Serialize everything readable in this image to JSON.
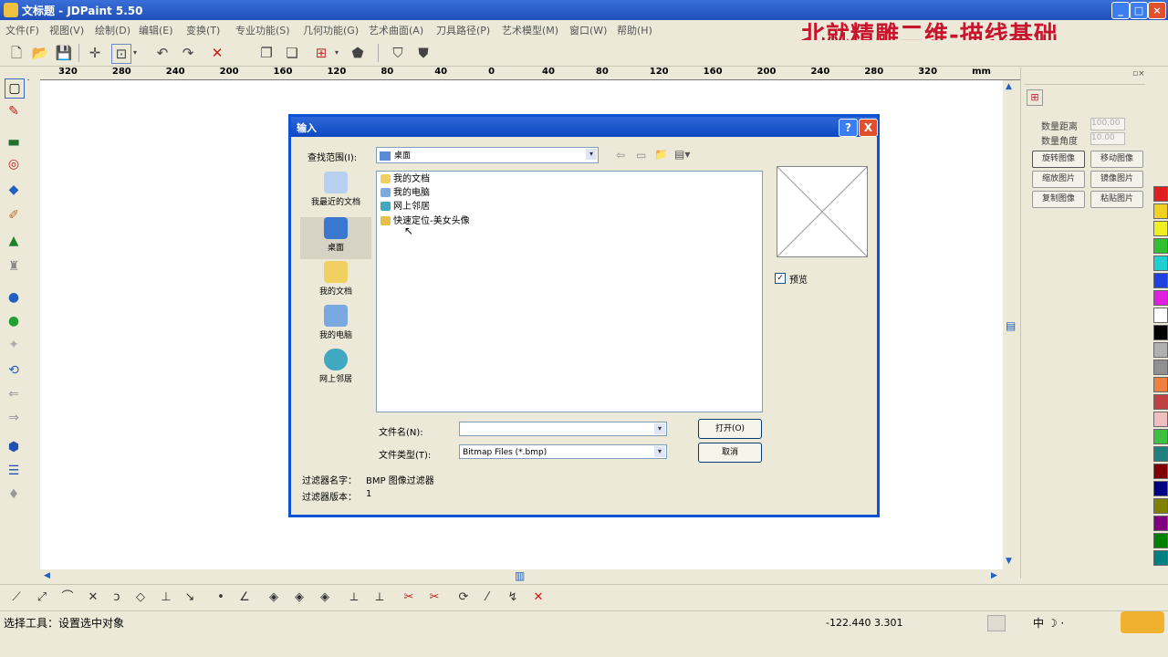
{
  "window": {
    "title": "文标题 - JDPaint 5.50"
  },
  "menu": [
    "文件(F)",
    "视图(V)",
    "绘制(D)",
    "编辑(E)",
    "变换(T)",
    "专业功能(S)",
    "几何功能(G)",
    "艺术曲面(A)",
    "刀具路径(P)",
    "艺术模型(M)",
    "窗口(W)",
    "帮助(H)"
  ],
  "overlay_title": "北就精雕二维-描线基础",
  "ruler_ticks": [
    "320",
    "280",
    "240",
    "200",
    "160",
    "120",
    "80",
    "40",
    "0",
    "40",
    "80",
    "120",
    "160",
    "200",
    "240",
    "280",
    "320",
    "mm"
  ],
  "right_panel": {
    "labels": [
      "数量距离",
      "数量角度"
    ],
    "input_values": [
      "100.00",
      "10.00"
    ],
    "buttons": [
      "旋转图像",
      "移动图像",
      "缩放图片",
      "镜像图片",
      "复制图像",
      "粘贴图片"
    ]
  },
  "palette": [
    "#e02020",
    "#f0d020",
    "#f0f020",
    "#30c030",
    "#20d0d0",
    "#2040e0",
    "#e020e0",
    "#ffffff",
    "#000000",
    "#b0b0b0",
    "#909090",
    "#f08040",
    "#c04040",
    "#f0c0c0",
    "#40c040",
    "#208080",
    "#800000",
    "#000080",
    "#808000",
    "#800080",
    "#008000",
    "#008080"
  ],
  "dialog": {
    "title": "输入",
    "help_btn": "?",
    "close_btn": "X",
    "look_in_label": "查找范围(I):",
    "look_in_value": "桌面",
    "places": [
      "我最近的文档",
      "桌面",
      "我的文档",
      "我的电脑",
      "网上邻居"
    ],
    "files": [
      "我的文档",
      "我的电脑",
      "网上邻居",
      "快速定位-美女头像"
    ],
    "preview_label": "预览",
    "preview_checked": true,
    "filename_label": "文件名(N):",
    "filename_value": "",
    "filetype_label": "文件类型(T):",
    "filetype_value": "Bitmap Files (*.bmp)",
    "open_btn": "打开(O)",
    "cancel_btn": "取消",
    "filter_name_label": "过滤器名字：",
    "filter_name_value": "BMP 图像过滤器",
    "filter_version_label": "过滤器版本：",
    "filter_version_value": "1"
  },
  "status": {
    "text": "选择工具：设置选中对象",
    "coords": "-122.440  3.301",
    "ime": "中 ☽ ·"
  }
}
